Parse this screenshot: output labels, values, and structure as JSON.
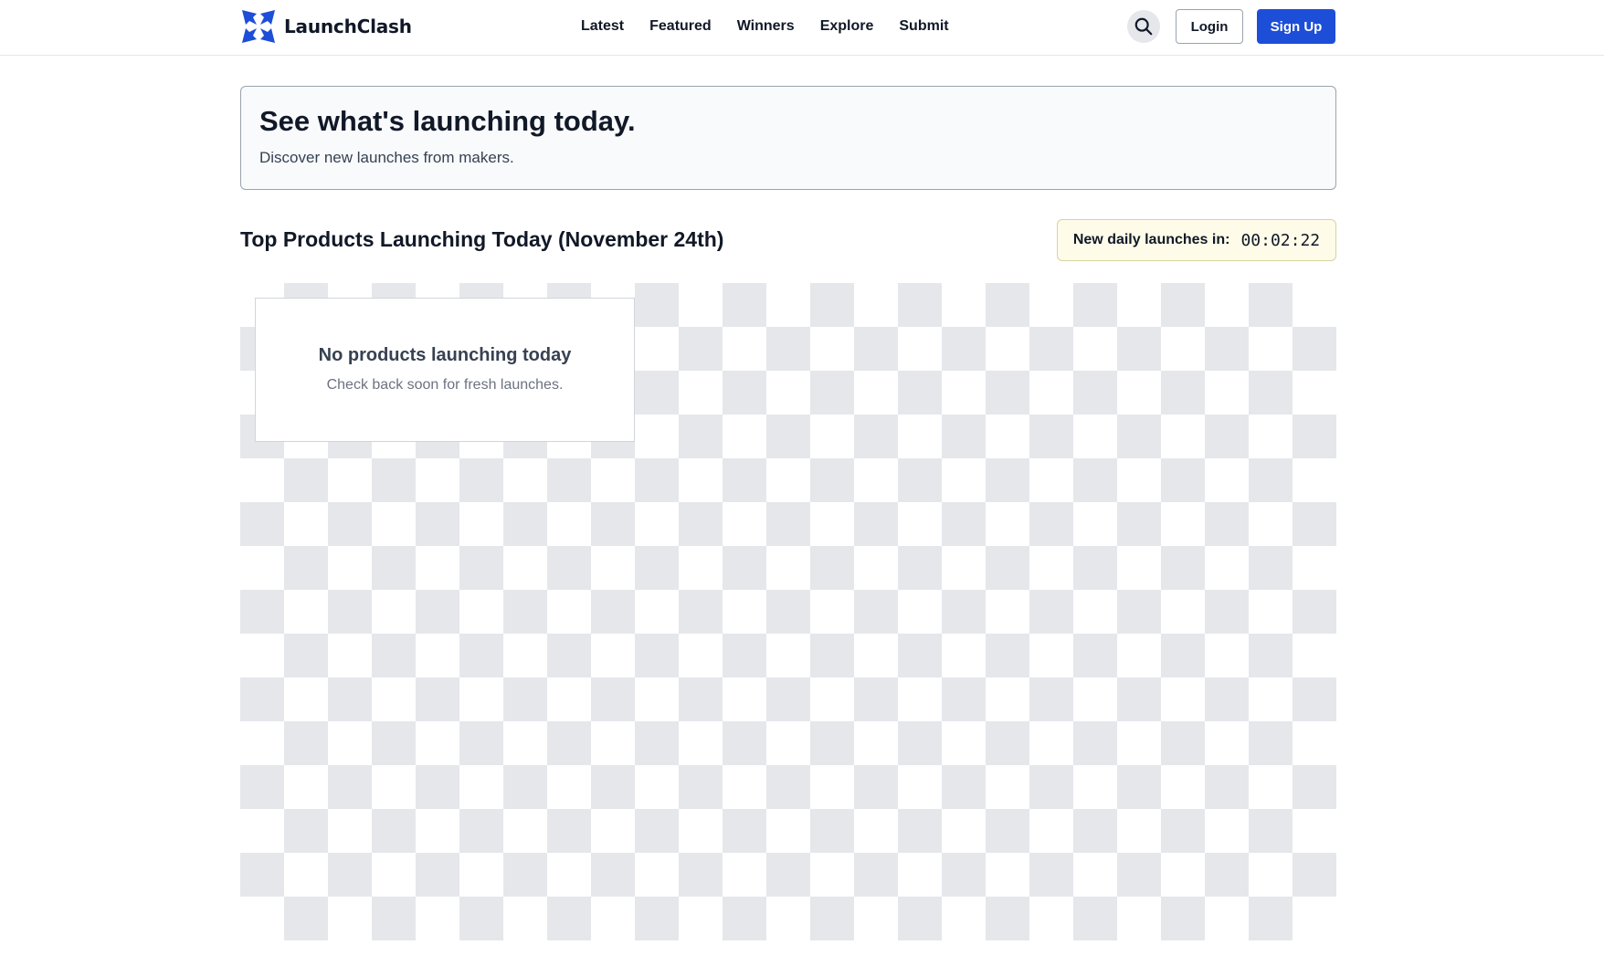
{
  "brand": {
    "name": "LaunchClash",
    "accent_color": "#1d4ed8",
    "logo_icon": "starburst-logo-icon"
  },
  "nav": {
    "items": [
      {
        "label": "Latest"
      },
      {
        "label": "Featured"
      },
      {
        "label": "Winners"
      },
      {
        "label": "Explore"
      },
      {
        "label": "Submit"
      }
    ]
  },
  "actions": {
    "search_icon": "search-icon",
    "login_label": "Login",
    "signup_label": "Sign Up"
  },
  "hero": {
    "title": "See what's launching today.",
    "subtitle": "Discover new launches from makers."
  },
  "section": {
    "title": "Top Products Launching Today (November 24th)"
  },
  "countdown": {
    "label": "New daily launches in:",
    "time": "00:02:22"
  },
  "empty_state": {
    "title": "No products launching today",
    "subtitle": "Check back soon for fresh launches."
  }
}
